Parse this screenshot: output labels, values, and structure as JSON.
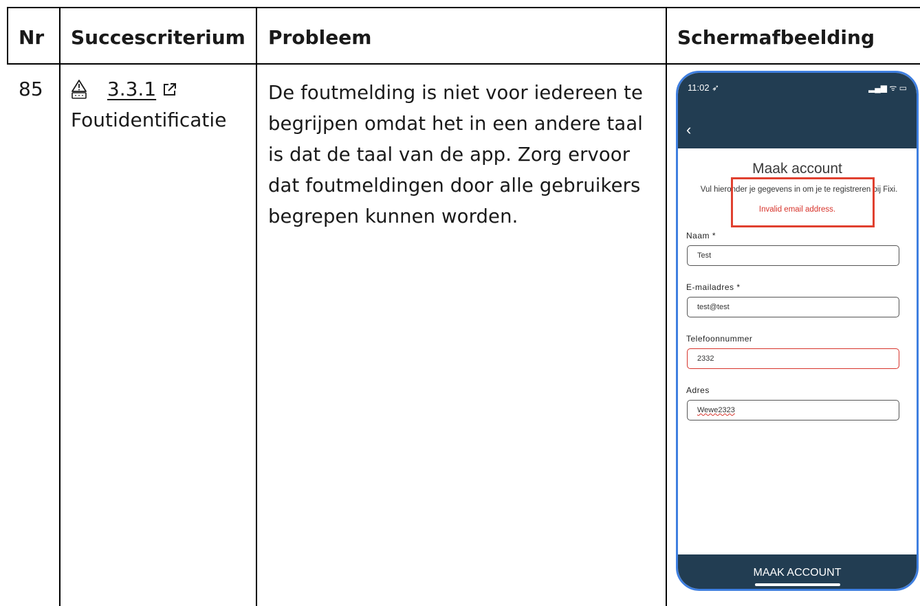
{
  "table": {
    "headers": {
      "nr": "Nr",
      "criterion": "Succescriterium",
      "problem": "Probleem",
      "screenshot": "Schermafbeelding"
    },
    "row": {
      "nr": "85",
      "criterion_icon": "warning-accessibility-icon",
      "criterion_code": "3.3.1",
      "criterion_link_icon": "external-link-icon",
      "criterion_name": "Foutidentificatie",
      "problem": "De foutmelding is niet voor iedereen te begrijpen omdat het in een andere taal is dat de taal van de app. Zorg ervoor dat foutmeldingen door alle gebruikers begrepen kunnen worden."
    }
  },
  "phone": {
    "time": "11:02 ➶",
    "status_icons": "▂▄▆ ᯤ ▭",
    "back": "‹",
    "title": "Maak account",
    "intro": "Vul hieronder je gegevens in om je te registreren bij Fixi.",
    "error": "Invalid email address.",
    "fields": [
      {
        "label": "Naam *",
        "value": "Test"
      },
      {
        "label": "E-mailadres *",
        "value": "test@test"
      },
      {
        "label": "Telefoonnummer",
        "value": "2332"
      },
      {
        "label": "Adres",
        "value": "Wewe2323"
      }
    ],
    "button": "MAAK ACCOUNT",
    "colors": {
      "header": "#223d52",
      "error": "#d7332b",
      "highlight": "#e0402f",
      "frame": "#3f7fe0"
    }
  }
}
